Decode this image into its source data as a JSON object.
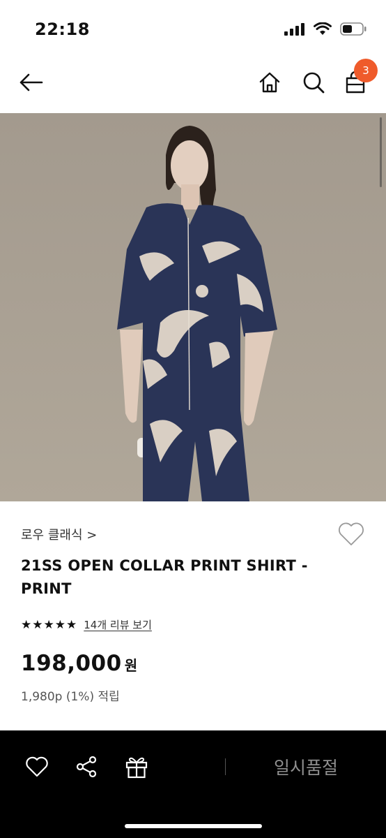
{
  "status_bar": {
    "time": "22:18"
  },
  "nav": {
    "cart_count": "3"
  },
  "product": {
    "brand": "로우 클래식 >",
    "title": "21SS OPEN COLLAR PRINT SHIRT - PRINT",
    "rating": 5,
    "review_link": "14개 리뷰 보기",
    "price": "198,000",
    "currency": "원",
    "points": "1,980p (1%) 적립"
  },
  "bottom_bar": {
    "soldout_label": "일시품절"
  },
  "icons": [
    "back-arrow-icon",
    "home-icon",
    "search-icon",
    "cart-icon",
    "heart-icon",
    "share-icon",
    "gift-icon",
    "star-icon",
    "signal-icon",
    "wifi-icon",
    "battery-icon"
  ],
  "colors": {
    "badge": "#ef5b2b",
    "bottom_bar": "#000000",
    "soldout_text": "#8f8f8f"
  }
}
